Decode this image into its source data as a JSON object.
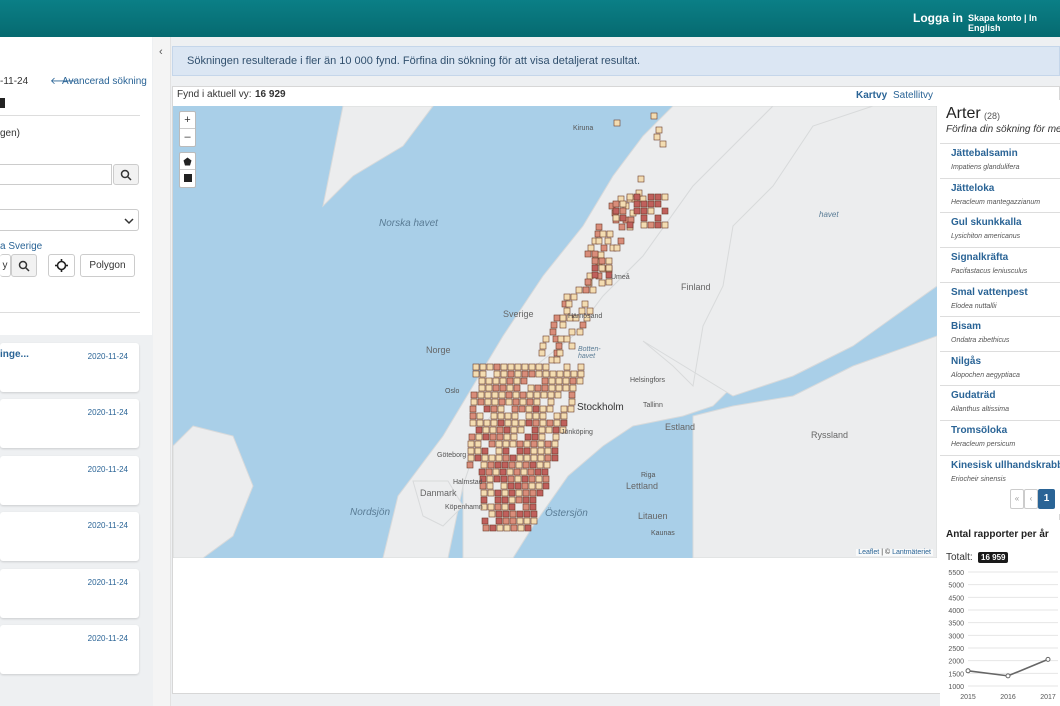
{
  "topbar": {
    "login": "Logga in",
    "create_account": "Skapa konto | In English"
  },
  "sidebar": {
    "date_fragment": "-11-24",
    "advanced_search": "Avancerad sökning",
    "paren_fragment": "gen)",
    "sweden_link": "a Sverige",
    "polygon_label": "Polygon",
    "card_title_first": "inge...",
    "card_dates": [
      "2020-11-24",
      "2020-11-24",
      "2020-11-24",
      "2020-11-24",
      "2020-11-24",
      "2020-11-24"
    ],
    "collapse_glyph": "‹"
  },
  "alert": {
    "text": "Sökningen resulterade i fler än 10 000 fynd. Förfina din sökning för att visa detaljerat resultat."
  },
  "map": {
    "count_label": "Fynd i aktuell vy:",
    "count_value": "16 929",
    "tab_map": "Kartvy",
    "tab_satellite": "Satellitvy",
    "zoom_in": "+",
    "zoom_out": "–",
    "attribution_leaflet": "Leaflet",
    "attribution_sep": " | © ",
    "attribution_lm": "Lantmäteriet",
    "labels": {
      "norska_havet": "Norska havet",
      "nordsjon": "Nordsjön",
      "ostersjon": "Östersjön",
      "bottenhavet": "Botten-\nhavet",
      "finland": "Finland",
      "norge": "Norge",
      "sverige": "Sverige",
      "danmark": "Danmark",
      "estland": "Estland",
      "ryssland": "Ryssland",
      "lettland": "Lettland",
      "litauen": "Litauen",
      "stockholm": "Stockholm",
      "kiruna": "Kiruna",
      "harnosand": "Härnösand",
      "helsingfors": "Helsingfors",
      "tallinn": "Tallinn",
      "oslo": "Oslo",
      "goteborg": "Göteborg",
      "halmstad": "Halmstad",
      "kopenhamn": "Köpenhamn",
      "riga": "Riga",
      "kaunas": "Kaunas",
      "jonkoping": "Jönköping",
      "umea": "Umeå"
    }
  },
  "species": {
    "title": "Arter",
    "count": "(28)",
    "subtitle": "Förfina din sökning för me",
    "items": [
      {
        "name": "Jättebalsamin",
        "sci": "Impatiens glandulifera"
      },
      {
        "name": "Jätteloka",
        "sci": "Heracleum mantegazzianum"
      },
      {
        "name": "Gul skunkkalla",
        "sci": "Lysichiton americanus"
      },
      {
        "name": "Signalkräfta",
        "sci": "Pacifastacus leniusculus"
      },
      {
        "name": "Smal vattenpest",
        "sci": "Elodea nuttallii"
      },
      {
        "name": "Bisam",
        "sci": "Ondatra zibethicus"
      },
      {
        "name": "Nilgås",
        "sci": "Alopochen aegyptiaca"
      },
      {
        "name": "Gudaträd",
        "sci": "Ailanthus altissima"
      },
      {
        "name": "Tromsöloka",
        "sci": "Heracleum persicum"
      },
      {
        "name": "Kinesisk ullhandskrabb",
        "sci": "Eriocheir sinensis"
      }
    ],
    "pager": {
      "first": "«",
      "prev": "‹",
      "current": "1"
    }
  },
  "yearly": {
    "title": "Antal rapporter per år",
    "total_label": "Totalt:",
    "total_value": "16 959"
  },
  "chart_data": {
    "type": "line",
    "title": "Antal rapporter per år",
    "x": [
      "2015",
      "2016",
      "2017"
    ],
    "series": [
      {
        "values": [
          1600,
          1400,
          2050
        ]
      }
    ],
    "ylim": [
      1000,
      5500
    ],
    "yticks": [
      1000,
      1500,
      2000,
      2500,
      3000,
      3500,
      4000,
      4500,
      5000,
      5500
    ],
    "grid": true
  },
  "colors": {
    "topbar": "#087880",
    "link": "#2a6496",
    "badge": "#1a1a1a",
    "sea": "#a9cfe8",
    "land": "#eceded",
    "cell_light": "#f3dcb1",
    "cell_dark": "#c0605c"
  }
}
